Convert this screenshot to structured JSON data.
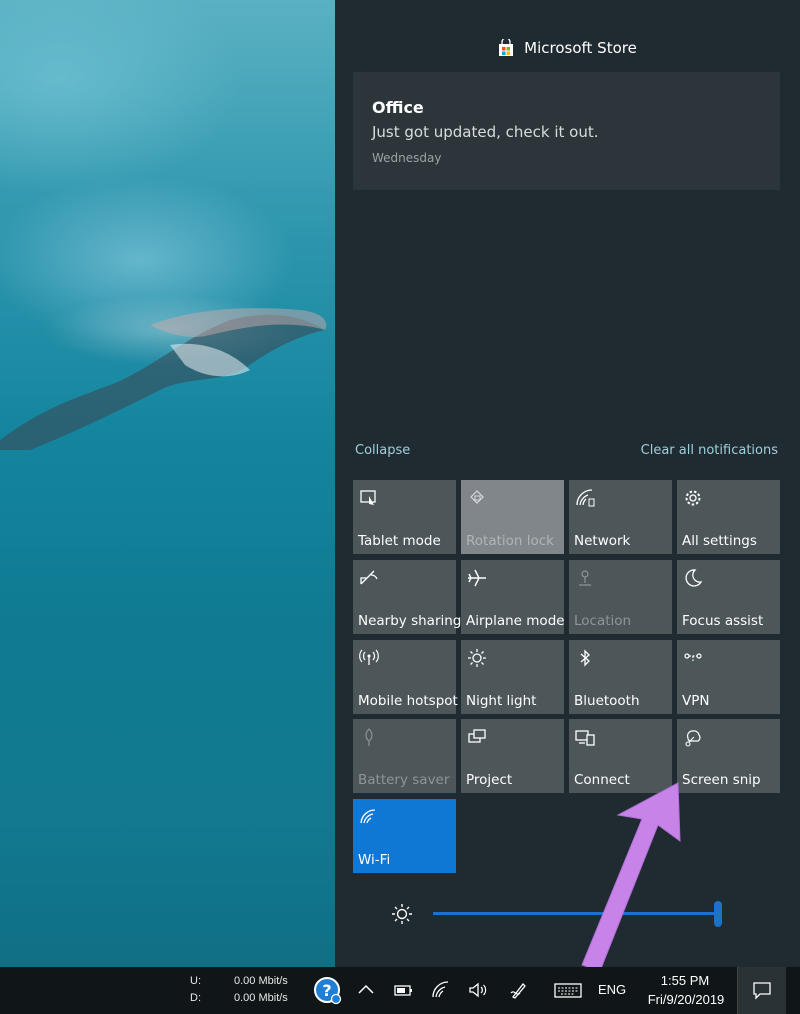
{
  "action_center": {
    "header": {
      "app_name": "Microsoft Store"
    },
    "notification": {
      "title": "Office",
      "body": "Just got updated, check it out.",
      "time": "Wednesday"
    },
    "collapse_label": "Collapse",
    "clear_all_label": "Clear all notifications",
    "quick_actions": [
      {
        "label": "Tablet mode",
        "icon": "tablet-mode-icon"
      },
      {
        "label": "Rotation lock",
        "icon": "rotation-lock-icon"
      },
      {
        "label": "Network",
        "icon": "network-icon"
      },
      {
        "label": "All settings",
        "icon": "gear-icon"
      },
      {
        "label": "Nearby sharing",
        "icon": "nearby-sharing-icon"
      },
      {
        "label": "Airplane mode",
        "icon": "airplane-icon"
      },
      {
        "label": "Location",
        "icon": "location-icon"
      },
      {
        "label": "Focus assist",
        "icon": "moon-icon"
      },
      {
        "label": "Mobile hotspot",
        "icon": "hotspot-icon"
      },
      {
        "label": "Night light",
        "icon": "night-light-icon"
      },
      {
        "label": "Bluetooth",
        "icon": "bluetooth-icon"
      },
      {
        "label": "VPN",
        "icon": "vpn-icon"
      },
      {
        "label": "Battery saver",
        "icon": "battery-saver-icon"
      },
      {
        "label": "Project",
        "icon": "project-icon"
      },
      {
        "label": "Connect",
        "icon": "connect-icon"
      },
      {
        "label": "Screen snip",
        "icon": "screen-snip-icon"
      },
      {
        "label": "Wi-Fi",
        "icon": "wifi-icon"
      }
    ],
    "brightness_level": 1.0,
    "accent_color": "#0f78d4",
    "annotation_arrow_color": "#c883e8"
  },
  "taskbar": {
    "upload_label": "U:",
    "download_label": "D:",
    "upload_speed": "0.00 Mbit/s",
    "download_speed": "0.00 Mbit/s",
    "language": "ENG",
    "time": "1:55 PM",
    "date": "Fri/9/20/2019"
  }
}
